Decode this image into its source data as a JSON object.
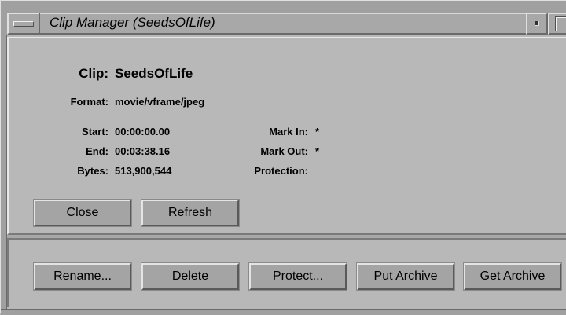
{
  "window": {
    "title": "Clip Manager (SeedsOfLife)"
  },
  "clip": {
    "clip_label": "Clip:",
    "clip_value": "SeedsOfLife",
    "format_label": "Format:",
    "format_value": "movie/vframe/jpeg",
    "start_label": "Start:",
    "start_value": "00:00:00.00",
    "end_label": "End:",
    "end_value": "00:03:38.16",
    "bytes_label": "Bytes:",
    "bytes_value": "513,900,544",
    "mark_in_label": "Mark In:",
    "mark_in_value": "*",
    "mark_out_label": "Mark Out:",
    "mark_out_value": "*",
    "protection_label": "Protection:",
    "protection_value": ""
  },
  "buttons": {
    "close": "Close",
    "refresh": "Refresh",
    "rename": "Rename...",
    "delete": "Delete",
    "protect": "Protect...",
    "put_archive": "Put Archive",
    "get_archive": "Get Archive"
  }
}
